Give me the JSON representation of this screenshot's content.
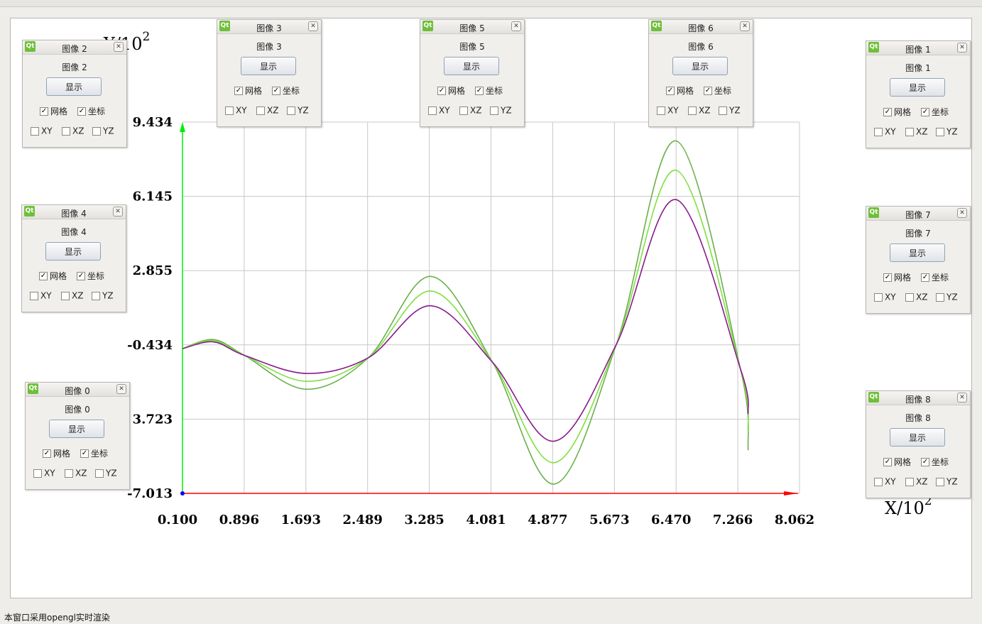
{
  "status_text": "本窗口采用opengl实时渲染",
  "panels": [
    {
      "title": "图像 2",
      "label": "图像 2",
      "button": "显示",
      "grid_label": "网格",
      "grid_checked": true,
      "axis_label": "坐标",
      "axis_checked": true,
      "xy": "XY",
      "xz": "XZ",
      "yz": "YZ",
      "xy_checked": false,
      "xz_checked": false,
      "yz_checked": false
    },
    {
      "title": "图像 3",
      "label": "图像 3",
      "button": "显示",
      "grid_label": "网格",
      "grid_checked": true,
      "axis_label": "坐标",
      "axis_checked": true,
      "xy": "XY",
      "xz": "XZ",
      "yz": "YZ",
      "xy_checked": false,
      "xz_checked": false,
      "yz_checked": false
    },
    {
      "title": "图像 5",
      "label": "图像 5",
      "button": "显示",
      "grid_label": "网格",
      "grid_checked": true,
      "axis_label": "坐标",
      "axis_checked": true,
      "xy": "XY",
      "xz": "XZ",
      "yz": "YZ",
      "xy_checked": false,
      "xz_checked": false,
      "yz_checked": false
    },
    {
      "title": "图像 6",
      "label": "图像 6",
      "button": "显示",
      "grid_label": "网格",
      "grid_checked": true,
      "axis_label": "坐标",
      "axis_checked": true,
      "xy": "XY",
      "xz": "XZ",
      "yz": "YZ",
      "xy_checked": false,
      "xz_checked": false,
      "yz_checked": false
    },
    {
      "title": "图像 1",
      "label": "图像 1",
      "button": "显示",
      "grid_label": "网格",
      "grid_checked": true,
      "axis_label": "坐标",
      "axis_checked": true,
      "xy": "XY",
      "xz": "XZ",
      "yz": "YZ",
      "xy_checked": false,
      "xz_checked": false,
      "yz_checked": false
    },
    {
      "title": "图像 4",
      "label": "图像 4",
      "button": "显示",
      "grid_label": "网格",
      "grid_checked": true,
      "axis_label": "坐标",
      "axis_checked": true,
      "xy": "XY",
      "xz": "XZ",
      "yz": "YZ",
      "xy_checked": false,
      "xz_checked": false,
      "yz_checked": false
    },
    {
      "title": "图像 7",
      "label": "图像 7",
      "button": "显示",
      "grid_label": "网格",
      "grid_checked": true,
      "axis_label": "坐标",
      "axis_checked": true,
      "xy": "XY",
      "xz": "XZ",
      "yz": "YZ",
      "xy_checked": false,
      "xz_checked": false,
      "yz_checked": false
    },
    {
      "title": "图像 0",
      "label": "图像 0",
      "button": "显示",
      "grid_label": "网格",
      "grid_checked": true,
      "axis_label": "坐标",
      "axis_checked": true,
      "xy": "XY",
      "xz": "XZ",
      "yz": "YZ",
      "xy_checked": false,
      "xz_checked": false,
      "yz_checked": false
    },
    {
      "title": "图像 8",
      "label": "图像 8",
      "button": "显示",
      "grid_label": "网格",
      "grid_checked": true,
      "axis_label": "坐标",
      "axis_checked": true,
      "xy": "XY",
      "xz": "XZ",
      "yz": "YZ",
      "xy_checked": false,
      "xz_checked": false,
      "yz_checked": false
    }
  ],
  "colors": {
    "grid": "#c8c8c8",
    "x_axis": "#ff0000",
    "y_axis": "#00ee00",
    "series": [
      "#6ab04c",
      "#7fe040",
      "#8a1a8e"
    ]
  },
  "chart_data": {
    "type": "line",
    "xlabel": "X/10",
    "xlabel_exp": "2",
    "ylabel": "Y/10",
    "ylabel_exp": "2",
    "x_ticks": [
      "0.100",
      "0.896",
      "1.693",
      "2.489",
      "3.285",
      "4.081",
      "4.877",
      "5.673",
      "6.470",
      "7.266",
      "8.062"
    ],
    "y_ticks": [
      "9.434",
      "6.145",
      "2.855",
      "-0.434",
      "3.723",
      "-7.013"
    ],
    "xlim": [
      0.1,
      8.062
    ],
    "ylim": [
      -7.013,
      9.434
    ],
    "grid": true,
    "series": [
      {
        "color": "#6ab04c",
        "points": [
          [
            0.1,
            -0.6
          ],
          [
            0.5,
            -0.2
          ],
          [
            0.9,
            -0.9
          ],
          [
            1.7,
            -2.4
          ],
          [
            2.5,
            -1.0
          ],
          [
            3.3,
            2.6
          ],
          [
            4.1,
            -1.2
          ],
          [
            4.9,
            -6.6
          ],
          [
            5.7,
            -0.4
          ],
          [
            6.47,
            8.6
          ],
          [
            7.3,
            -1.5
          ],
          [
            7.4,
            -5.1
          ]
        ]
      },
      {
        "color": "#7fe040",
        "points": [
          [
            0.1,
            -0.6
          ],
          [
            0.5,
            -0.25
          ],
          [
            0.9,
            -0.9
          ],
          [
            1.7,
            -2.05
          ],
          [
            2.5,
            -1.0
          ],
          [
            3.3,
            1.95
          ],
          [
            4.1,
            -1.2
          ],
          [
            4.9,
            -5.65
          ],
          [
            5.7,
            -0.4
          ],
          [
            6.47,
            7.3
          ],
          [
            7.3,
            -1.5
          ],
          [
            7.4,
            -4.3
          ]
        ]
      },
      {
        "color": "#8a1a8e",
        "points": [
          [
            0.1,
            -0.6
          ],
          [
            0.5,
            -0.3
          ],
          [
            0.9,
            -0.9
          ],
          [
            1.7,
            -1.7
          ],
          [
            2.5,
            -1.0
          ],
          [
            3.3,
            1.3
          ],
          [
            4.1,
            -1.2
          ],
          [
            4.9,
            -4.7
          ],
          [
            5.7,
            -0.4
          ],
          [
            6.47,
            6.0
          ],
          [
            7.3,
            -1.5
          ],
          [
            7.4,
            -3.5
          ]
        ]
      }
    ]
  }
}
